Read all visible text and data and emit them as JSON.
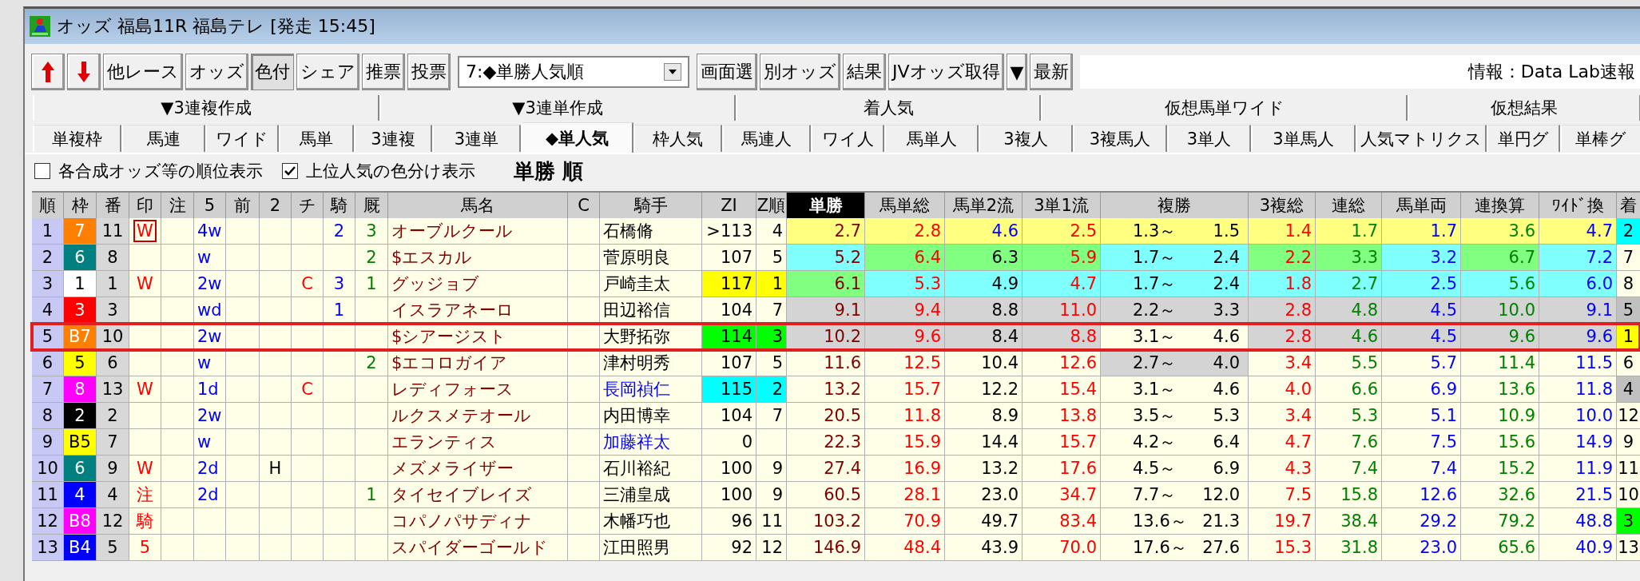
{
  "window": {
    "title": "オッズ 福島11R 福島テレ [発走 15:45]"
  },
  "toolbar": [
    {
      "kind": "up",
      "pressed": false
    },
    {
      "kind": "down",
      "pressed": false
    },
    {
      "kind": "button",
      "label": "他レース",
      "pressed": false
    },
    {
      "kind": "button",
      "label": "オッズ",
      "pressed": false
    },
    {
      "kind": "button",
      "label": "色付",
      "pressed": true
    },
    {
      "kind": "button",
      "label": "シェア",
      "pressed": false
    },
    {
      "kind": "button",
      "label": "推票",
      "pressed": false
    },
    {
      "kind": "button",
      "label": "投票",
      "pressed": false
    },
    {
      "kind": "dropdown",
      "label": "7:◆単勝人気順"
    },
    {
      "kind": "button",
      "label": "画面選",
      "pressed": false
    },
    {
      "kind": "button",
      "label": "別オッズ",
      "pressed": false
    },
    {
      "kind": "button",
      "label": "結果",
      "pressed": false
    },
    {
      "kind": "button",
      "label": "JVオッズ取得",
      "pressed": false
    },
    {
      "kind": "button",
      "label": "▼",
      "pressed": false
    },
    {
      "kind": "button",
      "label": "最新",
      "pressed": false
    }
  ],
  "info": "情報：Data Lab速報",
  "tab_groups": [
    {
      "label": "▼3連複作成"
    },
    {
      "label": "▼3連単作成"
    },
    {
      "label": "着人気"
    },
    {
      "label": "仮想馬単ワイド"
    },
    {
      "label": "仮想結果"
    }
  ],
  "tabs": [
    {
      "label": "単複枠",
      "selected": false
    },
    {
      "label": "馬連",
      "selected": false
    },
    {
      "label": "ワイド",
      "selected": false
    },
    {
      "label": "馬単",
      "selected": false
    },
    {
      "label": "3連複",
      "selected": false
    },
    {
      "label": "3連単",
      "selected": false
    },
    {
      "label": "◆単人気",
      "selected": true
    },
    {
      "label": "枠人気",
      "selected": false
    },
    {
      "label": "馬連人",
      "selected": false
    },
    {
      "label": "ワイ人",
      "selected": false
    },
    {
      "label": "馬単人",
      "selected": false
    },
    {
      "label": "3複人",
      "selected": false
    },
    {
      "label": "3複馬人",
      "selected": false
    },
    {
      "label": "3単人",
      "selected": false
    },
    {
      "label": "3単馬人",
      "selected": false
    },
    {
      "label": "人気マトリクス",
      "selected": false
    },
    {
      "label": "単円グ",
      "selected": false
    },
    {
      "label": "単棒グ",
      "selected": false
    }
  ],
  "options": [
    {
      "label": "各合成オッズ等の順位表示",
      "checked": false
    },
    {
      "label": "上位人気の色分け表示",
      "checked": true
    }
  ],
  "heading": "単勝 順",
  "columns": [
    {
      "label": "順",
      "selected": false
    },
    {
      "label": "枠",
      "selected": false
    },
    {
      "label": "番",
      "selected": false
    },
    {
      "label": "印",
      "selected": false
    },
    {
      "label": "注",
      "selected": false
    },
    {
      "label": "5",
      "selected": false
    },
    {
      "label": "前",
      "selected": false
    },
    {
      "label": "2",
      "selected": false
    },
    {
      "label": "チ",
      "selected": false
    },
    {
      "label": "騎",
      "selected": false
    },
    {
      "label": "厩",
      "selected": false
    },
    {
      "label": "馬名",
      "selected": false
    },
    {
      "label": "C",
      "selected": false
    },
    {
      "label": "騎手",
      "selected": false
    },
    {
      "label": "ZI",
      "selected": false
    },
    {
      "label": "Z順",
      "selected": false
    },
    {
      "label": "単勝",
      "selected": true
    },
    {
      "label": "馬単総",
      "selected": false
    },
    {
      "label": "馬単2流",
      "selected": false
    },
    {
      "label": "3単1流",
      "selected": false
    },
    {
      "label": "複勝",
      "selected": false
    },
    {
      "label": "3複総",
      "selected": false
    },
    {
      "label": "連総",
      "selected": false
    },
    {
      "label": "馬単両",
      "selected": false
    },
    {
      "label": "連換算",
      "selected": false
    },
    {
      "label": "ﾜｲﾄﾞ換",
      "selected": false
    },
    {
      "label": "着",
      "selected": false
    }
  ],
  "rows": [
    {
      "selected": false,
      "rank": "1",
      "waku": {
        "text": "7",
        "color": "#ff8000"
      },
      "num": "11",
      "mark": {
        "text": "W",
        "boxed": true
      },
      "five": "4w",
      "ki": "2",
      "kyu": "3",
      "name": "オーブルクール",
      "jockey": {
        "text": "石橋脩"
      },
      "zi": {
        "text": ">113"
      },
      "zrank": {
        "text": "4"
      },
      "odds": [
        {
          "text": "2.7",
          "color": "#ffff80"
        },
        {
          "text": "2.8",
          "color": "#ffff80"
        },
        {
          "text": "4.6",
          "color": "#ffff80",
          "font": {
            "color": "#0000ff"
          }
        },
        {
          "text": "2.5",
          "color": "#ffff80"
        },
        {
          "text": "1.4",
          "color": "#ffff80"
        },
        {
          "text": "1.7",
          "color": "#ffff80"
        },
        {
          "text": "1.7",
          "color": "#ffff80"
        },
        {
          "text": "3.6",
          "color": "#ffff80"
        },
        {
          "text": "4.7",
          "color": "#ffff80"
        }
      ],
      "place": {
        "low": "1.3～",
        "high": "1.5",
        "color": "#ffff80"
      },
      "finish": {
        "text": "2",
        "color": "#00ffff"
      }
    },
    {
      "selected": false,
      "rank": "2",
      "waku": {
        "text": "6",
        "color": "#008080"
      },
      "num": "8",
      "five": "w",
      "kyu": "2",
      "name": "$エスカル",
      "jockey": {
        "text": "菅原明良"
      },
      "zi": {
        "text": "107"
      },
      "zrank": {
        "text": "5"
      },
      "odds": [
        {
          "text": "5.2",
          "color": "#80ffff"
        },
        {
          "text": "6.4",
          "color": "#80ff80"
        },
        {
          "text": "6.3",
          "color": "#80ff80"
        },
        {
          "text": "5.9",
          "color": "#80ff80"
        },
        {
          "text": "2.2",
          "color": "#80ff80"
        },
        {
          "text": "3.3",
          "color": "#80ff80"
        },
        {
          "text": "3.2",
          "color": "#80ffff"
        },
        {
          "text": "6.7",
          "color": "#80ff80"
        },
        {
          "text": "7.2",
          "color": "#80ffff"
        }
      ],
      "place": {
        "low": "1.7～",
        "high": "2.4",
        "color": "#80ffff"
      },
      "finish": {
        "text": "7"
      }
    },
    {
      "selected": false,
      "rank": "3",
      "waku": {
        "text": "1",
        "color": "#ffffff"
      },
      "num": "1",
      "mark": {
        "text": "W",
        "boxed": false
      },
      "five": "2w",
      "chi": "C",
      "ki": "3",
      "kyu": "1",
      "name": "グッジョブ",
      "jockey": {
        "text": "戸崎圭太"
      },
      "zi": {
        "text": "117",
        "color": "#ffff00"
      },
      "zrank": {
        "text": "1",
        "color": "#ffff00"
      },
      "odds": [
        {
          "text": "6.1",
          "color": "#80ff80"
        },
        {
          "text": "5.3",
          "color": "#80ffff"
        },
        {
          "text": "4.9",
          "color": "#80ffff"
        },
        {
          "text": "4.7",
          "color": "#80ffff"
        },
        {
          "text": "1.8",
          "color": "#80ffff"
        },
        {
          "text": "2.7",
          "color": "#80ffff"
        },
        {
          "text": "2.5",
          "color": "#80ffff"
        },
        {
          "text": "5.6",
          "color": "#80ffff"
        },
        {
          "text": "6.0",
          "color": "#80ffff"
        }
      ],
      "place": {
        "low": "1.7～",
        "high": "2.4",
        "color": "#80ffff"
      },
      "finish": {
        "text": "8"
      }
    },
    {
      "selected": false,
      "rank": "4",
      "waku": {
        "text": "3",
        "color": "#ff0000"
      },
      "num": "3",
      "five": "wd",
      "ki": "1",
      "name": "イスラアネーロ",
      "jockey": {
        "text": "田辺裕信"
      },
      "zi": {
        "text": "104"
      },
      "zrank": {
        "text": "7"
      },
      "odds": [
        {
          "text": "9.1",
          "color": "#d4d4d4"
        },
        {
          "text": "9.4",
          "color": "#d4d4d4"
        },
        {
          "text": "8.8",
          "color": "#d4d4d4"
        },
        {
          "text": "11.0",
          "color": "#d4d4d4"
        },
        {
          "text": "2.8",
          "color": "#d4d4d4"
        },
        {
          "text": "4.8",
          "color": "#d4d4d4"
        },
        {
          "text": "4.5",
          "color": "#d4d4d4"
        },
        {
          "text": "10.0",
          "color": "#d4d4d4"
        },
        {
          "text": "9.1",
          "color": "#d4d4d4"
        }
      ],
      "place": {
        "low": "2.2～",
        "high": "3.3",
        "color": "#d4d4d4"
      },
      "finish": {
        "text": "5",
        "color": "#c0c0c0"
      }
    },
    {
      "selected": true,
      "rank": "5",
      "waku": {
        "text": "B7",
        "color": "#ff8000"
      },
      "num": "10",
      "five": "2w",
      "name": "$シアージスト",
      "jockey": {
        "text": "大野拓弥"
      },
      "zi": {
        "text": "114",
        "color": "#00ff00"
      },
      "zrank": {
        "text": "3",
        "color": "#00ff00"
      },
      "odds": [
        {
          "text": "10.2",
          "color": "#d4d4d4"
        },
        {
          "text": "9.6",
          "color": "#d4d4d4"
        },
        {
          "text": "8.4",
          "color": "#d4d4d4"
        },
        {
          "text": "8.8",
          "color": "#d4d4d4"
        },
        {
          "text": "2.8",
          "color": "#d4d4d4"
        },
        {
          "text": "4.6",
          "color": "#d4d4d4"
        },
        {
          "text": "4.5",
          "color": "#d4d4d4"
        },
        {
          "text": "9.6",
          "color": "#d4d4d4"
        },
        {
          "text": "9.6",
          "color": "#d4d4d4"
        }
      ],
      "place": {
        "low": "3.1～",
        "high": "4.6"
      },
      "finish": {
        "text": "1",
        "color": "#ffff00"
      }
    },
    {
      "selected": false,
      "rank": "6",
      "waku": {
        "text": "5",
        "color": "#ffff00"
      },
      "num": "6",
      "five": "w",
      "kyu": "2",
      "name": "$エコロガイア",
      "jockey": {
        "text": "津村明秀"
      },
      "zi": {
        "text": "107"
      },
      "zrank": {
        "text": "5"
      },
      "odds": [
        {
          "text": "11.6"
        },
        {
          "text": "12.5"
        },
        {
          "text": "10.4"
        },
        {
          "text": "12.6"
        },
        {
          "text": "3.4"
        },
        {
          "text": "5.5"
        },
        {
          "text": "5.7"
        },
        {
          "text": "11.4"
        },
        {
          "text": "11.5"
        }
      ],
      "place": {
        "low": "2.7～",
        "high": "4.0",
        "color": "#d4d4d4"
      },
      "finish": {
        "text": "6"
      }
    },
    {
      "selected": false,
      "rank": "7",
      "waku": {
        "text": "8",
        "color": "#ff00ff"
      },
      "num": "13",
      "mark": {
        "text": "W",
        "boxed": false
      },
      "five": "1d",
      "chi": "C",
      "name": "レディフォース",
      "jockey": {
        "text": "長岡禎仁",
        "color": "#0000ff"
      },
      "zi": {
        "text": "115",
        "color": "#00ffff"
      },
      "zrank": {
        "text": "2",
        "color": "#00ffff"
      },
      "odds": [
        {
          "text": "13.2"
        },
        {
          "text": "15.7"
        },
        {
          "text": "12.2"
        },
        {
          "text": "15.4"
        },
        {
          "text": "4.0"
        },
        {
          "text": "6.6"
        },
        {
          "text": "6.9"
        },
        {
          "text": "13.6"
        },
        {
          "text": "11.8"
        }
      ],
      "place": {
        "low": "3.1～",
        "high": "4.6"
      },
      "finish": {
        "text": "4",
        "color": "#c0c0c0"
      }
    },
    {
      "selected": false,
      "rank": "8",
      "waku": {
        "text": "2",
        "color": "#000000"
      },
      "num": "2",
      "five": "2w",
      "name": "ルクスメテオール",
      "jockey": {
        "text": "内田博幸"
      },
      "zi": {
        "text": "104"
      },
      "zrank": {
        "text": "7"
      },
      "odds": [
        {
          "text": "20.5"
        },
        {
          "text": "11.8"
        },
        {
          "text": "8.9"
        },
        {
          "text": "13.8"
        },
        {
          "text": "3.4"
        },
        {
          "text": "5.3"
        },
        {
          "text": "5.1"
        },
        {
          "text": "10.9"
        },
        {
          "text": "10.0"
        }
      ],
      "place": {
        "low": "3.5～",
        "high": "5.3"
      },
      "finish": {
        "text": "12"
      }
    },
    {
      "selected": false,
      "rank": "9",
      "waku": {
        "text": "B5",
        "color": "#ffff00"
      },
      "num": "7",
      "five": "w",
      "name": "エランティス",
      "jockey": {
        "text": "加藤祥太",
        "color": "#0000ff"
      },
      "zi": {
        "text": "0"
      },
      "odds": [
        {
          "text": "22.3"
        },
        {
          "text": "15.9"
        },
        {
          "text": "14.4"
        },
        {
          "text": "15.7"
        },
        {
          "text": "4.7"
        },
        {
          "text": "7.6"
        },
        {
          "text": "7.5"
        },
        {
          "text": "15.6"
        },
        {
          "text": "14.9"
        }
      ],
      "place": {
        "low": "4.2～",
        "high": "6.4"
      },
      "finish": {
        "text": "9"
      }
    },
    {
      "selected": false,
      "rank": "10",
      "waku": {
        "text": "6",
        "color": "#008080"
      },
      "num": "9",
      "mark": {
        "text": "W",
        "boxed": false
      },
      "five": "2d",
      "two": "H",
      "name": "メズメライザー",
      "jockey": {
        "text": "石川裕紀"
      },
      "zi": {
        "text": "100"
      },
      "zrank": {
        "text": "9"
      },
      "odds": [
        {
          "text": "27.4"
        },
        {
          "text": "16.9"
        },
        {
          "text": "13.2"
        },
        {
          "text": "17.6"
        },
        {
          "text": "4.3"
        },
        {
          "text": "7.4"
        },
        {
          "text": "7.4"
        },
        {
          "text": "15.2"
        },
        {
          "text": "11.9"
        }
      ],
      "place": {
        "low": "4.5～",
        "high": "6.9"
      },
      "finish": {
        "text": "11"
      }
    },
    {
      "selected": false,
      "rank": "11",
      "waku": {
        "text": "4",
        "color": "#0000ff"
      },
      "num": "4",
      "mark": {
        "text": "注",
        "boxed": false
      },
      "five": "2d",
      "kyu": "1",
      "name": "タイセイブレイズ",
      "jockey": {
        "text": "三浦皇成"
      },
      "zi": {
        "text": "100"
      },
      "zrank": {
        "text": "9"
      },
      "odds": [
        {
          "text": "60.5"
        },
        {
          "text": "28.1"
        },
        {
          "text": "23.0"
        },
        {
          "text": "34.7"
        },
        {
          "text": "7.5"
        },
        {
          "text": "15.8"
        },
        {
          "text": "12.6"
        },
        {
          "text": "32.6"
        },
        {
          "text": "21.5"
        }
      ],
      "place": {
        "low": "7.7～",
        "high": "12.0"
      },
      "finish": {
        "text": "10"
      }
    },
    {
      "selected": false,
      "rank": "12",
      "waku": {
        "text": "B8",
        "color": "#ff00ff"
      },
      "num": "12",
      "mark": {
        "text": "騎",
        "boxed": false
      },
      "name": "コパノパサディナ",
      "jockey": {
        "text": "木幡巧也"
      },
      "zi": {
        "text": "96"
      },
      "zrank": {
        "text": "11"
      },
      "odds": [
        {
          "text": "103.2"
        },
        {
          "text": "70.9"
        },
        {
          "text": "49.7"
        },
        {
          "text": "83.4"
        },
        {
          "text": "19.7"
        },
        {
          "text": "38.4"
        },
        {
          "text": "29.2"
        },
        {
          "text": "79.2"
        },
        {
          "text": "48.8"
        }
      ],
      "place": {
        "low": "13.6～",
        "high": "21.3"
      },
      "finish": {
        "text": "3",
        "color": "#00ff00"
      }
    },
    {
      "selected": false,
      "rank": "13",
      "waku": {
        "text": "B4",
        "color": "#0000ff"
      },
      "num": "5",
      "mark": {
        "text": "5",
        "boxed": false
      },
      "name": "スパイダーゴールド",
      "jockey": {
        "text": "江田照男"
      },
      "zi": {
        "text": "92"
      },
      "zrank": {
        "text": "12"
      },
      "odds": [
        {
          "text": "146.9"
        },
        {
          "text": "48.4"
        },
        {
          "text": "43.9"
        },
        {
          "text": "70.0"
        },
        {
          "text": "15.3"
        },
        {
          "text": "31.8"
        },
        {
          "text": "23.0"
        },
        {
          "text": "65.6"
        },
        {
          "text": "40.9"
        }
      ],
      "place": {
        "low": "17.6～",
        "high": "27.6"
      },
      "finish": {
        "text": "13"
      }
    }
  ]
}
